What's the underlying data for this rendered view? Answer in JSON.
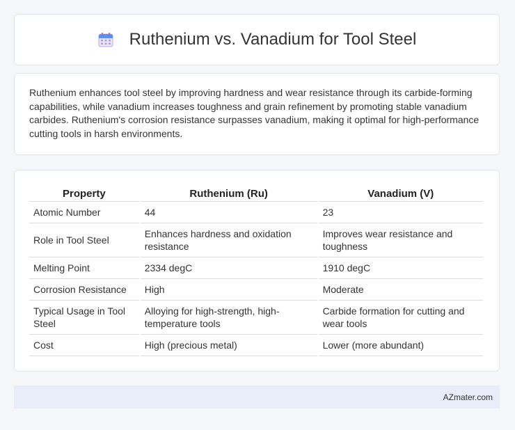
{
  "header": {
    "title": "Ruthenium vs. Vanadium for Tool Steel",
    "icon": "calendar-icon"
  },
  "summary": {
    "text": "Ruthenium enhances tool steel by improving hardness and wear resistance through its carbide-forming capabilities, while vanadium increases toughness and grain refinement by promoting stable vanadium carbides. Ruthenium's corrosion resistance surpasses vanadium, making it optimal for high-performance cutting tools in harsh environments."
  },
  "table": {
    "headers": [
      "Property",
      "Ruthenium (Ru)",
      "Vanadium (V)"
    ],
    "rows": [
      [
        "Atomic Number",
        "44",
        "23"
      ],
      [
        "Role in Tool Steel",
        "Enhances hardness and oxidation resistance",
        "Improves wear resistance and toughness"
      ],
      [
        "Melting Point",
        "2334 degC",
        "1910 degC"
      ],
      [
        "Corrosion Resistance",
        "High",
        "Moderate"
      ],
      [
        "Typical Usage in Tool Steel",
        "Alloying for high-strength, high-temperature tools",
        "Carbide formation for cutting and wear tools"
      ],
      [
        "Cost",
        "High (precious metal)",
        "Lower (more abundant)"
      ]
    ]
  },
  "footer": {
    "brand": "AZmater.com"
  }
}
